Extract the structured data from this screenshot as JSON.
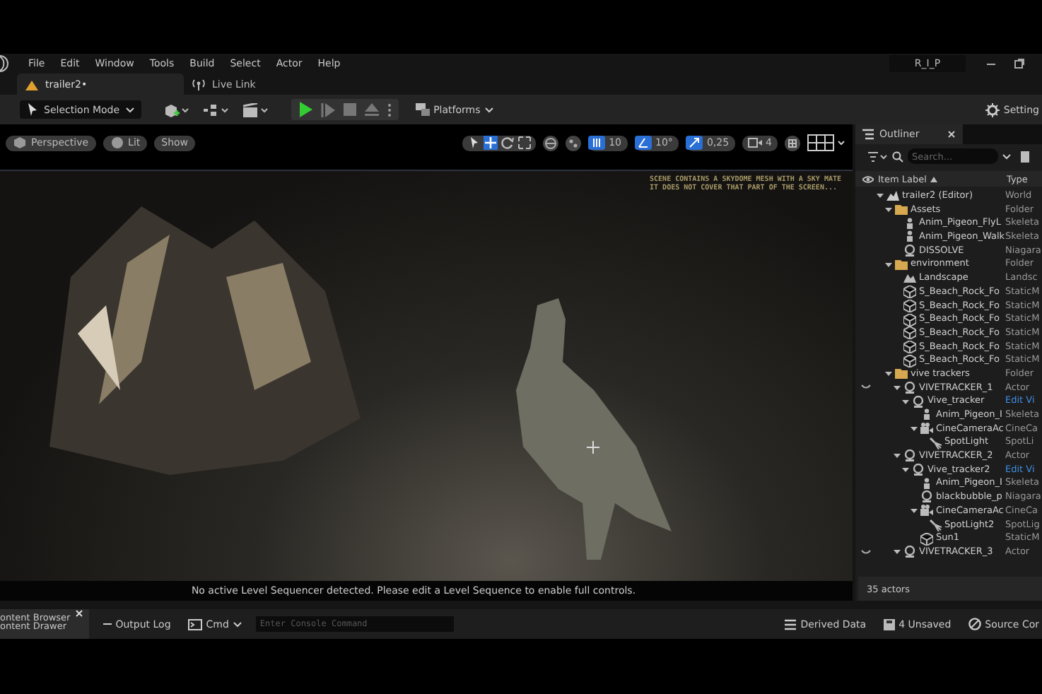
{
  "menu_bar": {
    "items": [
      "File",
      "Edit",
      "Window",
      "Tools",
      "Build",
      "Select",
      "Actor",
      "Help"
    ],
    "project": "R_I_P"
  },
  "tabs": [
    {
      "label": "trailer2•",
      "selected": true
    },
    {
      "label": "Live Link",
      "selected": false
    }
  ],
  "toolbar": {
    "mode": "Selection Mode",
    "platforms": "Platforms",
    "settings": "Setting"
  },
  "viewport": {
    "buttons": [
      "Perspective",
      "Lit",
      "Show"
    ],
    "grid_snap": "10",
    "rotation_snap": "10°",
    "scale_snap": "0,25",
    "camera_speed": "4",
    "warning_lines": [
      "SCENE CONTAINS A SKYDOME MESH WITH A SKY MATE",
      "IT DOES NOT COVER THAT PART OF THE SCREEN..."
    ],
    "message": "No active Level Sequencer detected. Please edit a Level Sequence to enable full controls."
  },
  "outliner": {
    "title": "Outliner",
    "search_placeholder": "Search...",
    "columns": [
      "Item Label",
      "Type"
    ],
    "count": "35 actors",
    "tree": [
      {
        "label": "trailer2 (Editor)",
        "type": "World",
        "kind": "world",
        "type_link": false,
        "eye_closed": false,
        "expanded": true,
        "children": [
          {
            "label": "Assets",
            "type": "Folder",
            "kind": "folder",
            "type_link": false,
            "eye_closed": false,
            "expanded": true,
            "children": [
              {
                "label": "Anim_Pigeon_FlyL",
                "type": "Skeleta",
                "kind": "skeletal",
                "type_link": false,
                "eye_closed": false
              },
              {
                "label": "Anim_Pigeon_Walk",
                "type": "Skeleta",
                "kind": "skeletal",
                "type_link": false,
                "eye_closed": false
              },
              {
                "label": "DISSOLVE",
                "type": "Niagara",
                "kind": "actor",
                "type_link": false,
                "eye_closed": false
              }
            ]
          },
          {
            "label": "environment",
            "type": "Folder",
            "kind": "folder",
            "type_link": false,
            "eye_closed": false,
            "expanded": true,
            "children": [
              {
                "label": "Landscape",
                "type": "Landsc",
                "kind": "landscape",
                "type_link": false,
                "eye_closed": false
              },
              {
                "label": "S_Beach_Rock_Fo",
                "type": "StaticM",
                "kind": "static",
                "type_link": false,
                "eye_closed": false
              },
              {
                "label": "S_Beach_Rock_Fo",
                "type": "StaticM",
                "kind": "static",
                "type_link": false,
                "eye_closed": false
              },
              {
                "label": "S_Beach_Rock_Fo",
                "type": "StaticM",
                "kind": "static",
                "type_link": false,
                "eye_closed": false
              },
              {
                "label": "S_Beach_Rock_Fo",
                "type": "StaticM",
                "kind": "static",
                "type_link": false,
                "eye_closed": false
              },
              {
                "label": "S_Beach_Rock_Fo",
                "type": "StaticM",
                "kind": "static",
                "type_link": false,
                "eye_closed": false
              },
              {
                "label": "S_Beach_Rock_Fo",
                "type": "StaticM",
                "kind": "static",
                "type_link": false,
                "eye_closed": false
              }
            ]
          },
          {
            "label": "vive trackers",
            "type": "Folder",
            "kind": "folder",
            "type_link": false,
            "eye_closed": false,
            "expanded": true,
            "children": [
              {
                "label": "VIVETRACKER_1",
                "type": "Actor",
                "kind": "actor",
                "type_link": false,
                "eye_closed": true,
                "expanded": true,
                "children": [
                  {
                    "label": "Vive_tracker",
                    "type": "Edit Vi",
                    "kind": "actor",
                    "type_link": true,
                    "eye_closed": false,
                    "expanded": true,
                    "children": [
                      {
                        "label": "Anim_Pigeon_I",
                        "type": "Skeleta",
                        "kind": "skeletal",
                        "type_link": false,
                        "eye_closed": false
                      },
                      {
                        "label": "CineCameraAc",
                        "type": "CineCa",
                        "kind": "camera",
                        "type_link": false,
                        "eye_closed": false,
                        "expanded": true,
                        "children": [
                          {
                            "label": "SpotLight",
                            "type": "SpotLi",
                            "kind": "light",
                            "type_link": false,
                            "eye_closed": false
                          }
                        ]
                      }
                    ]
                  }
                ]
              },
              {
                "label": "VIVETRACKER_2",
                "type": "Actor",
                "kind": "actor",
                "type_link": false,
                "eye_closed": false,
                "expanded": true,
                "children": [
                  {
                    "label": "Vive_tracker2",
                    "type": "Edit Vi",
                    "kind": "actor",
                    "type_link": true,
                    "eye_closed": false,
                    "expanded": true,
                    "children": [
                      {
                        "label": "Anim_Pigeon_I",
                        "type": "Skeleta",
                        "kind": "skeletal",
                        "type_link": false,
                        "eye_closed": false
                      },
                      {
                        "label": "blackbubble_p",
                        "type": "Niagara",
                        "kind": "actor",
                        "type_link": false,
                        "eye_closed": false
                      },
                      {
                        "label": "CineCameraAc",
                        "type": "CineCa",
                        "kind": "camera",
                        "type_link": false,
                        "eye_closed": false,
                        "expanded": true,
                        "children": [
                          {
                            "label": "SpotLight2",
                            "type": "SpotLig",
                            "kind": "light",
                            "type_link": false,
                            "eye_closed": false
                          }
                        ]
                      },
                      {
                        "label": "Sun1",
                        "type": "StaticM",
                        "kind": "static",
                        "type_link": false,
                        "eye_closed": false
                      }
                    ]
                  }
                ]
              },
              {
                "label": "VIVETRACKER_3",
                "type": "Actor",
                "kind": "actor",
                "type_link": false,
                "eye_closed": true,
                "expanded": true
              }
            ]
          }
        ]
      }
    ]
  },
  "bottom_bar": {
    "tabs": [
      "ontent Browser",
      "ontent Drawer"
    ],
    "output_log": "Output Log",
    "cmd": "Cmd",
    "console_placeholder": "Enter Console Command",
    "derived_data": "Derived Data",
    "unsaved": "4 Unsaved",
    "source_control": "Source Cor"
  }
}
